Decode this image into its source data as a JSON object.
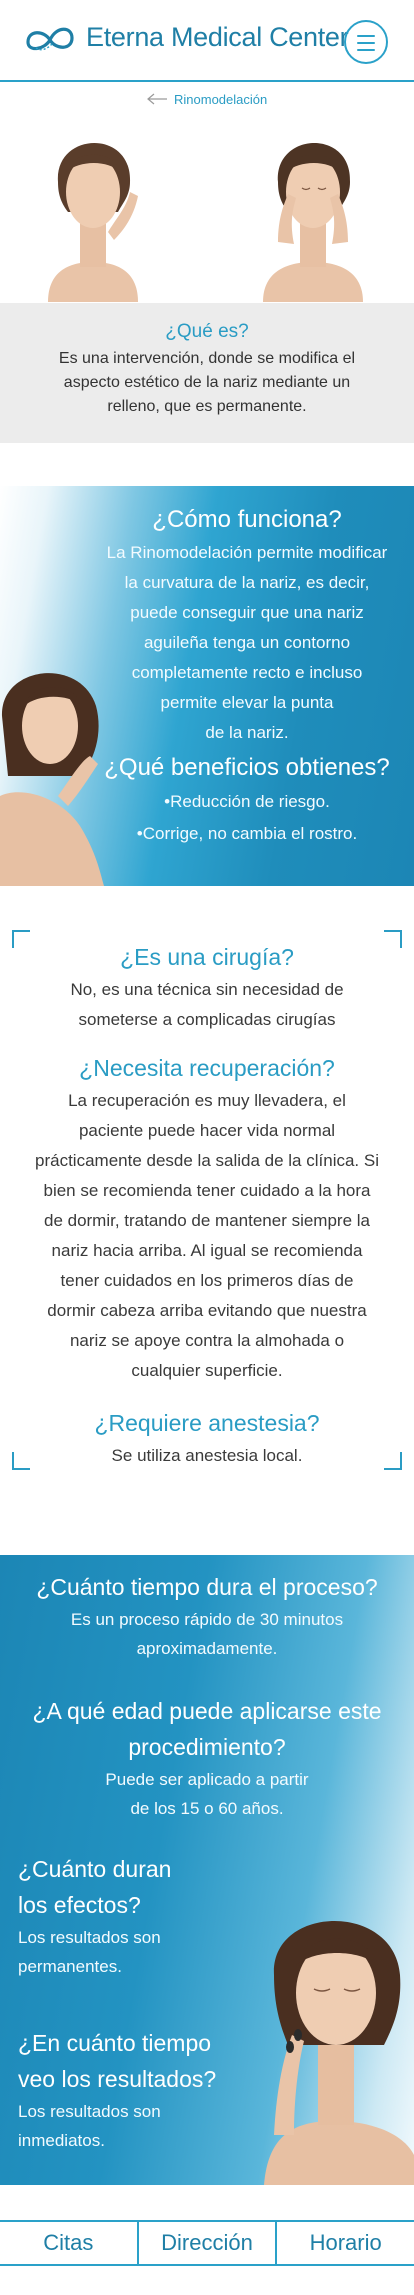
{
  "header": {
    "brand": "Eterna Medical Center",
    "logo_icon": "infinity-logo-icon",
    "menu_icon": "hamburger-menu-icon"
  },
  "breadcrumb": {
    "icon": "arrow-left-icon",
    "label": "Rinomodelación"
  },
  "colors": {
    "accent": "#2aa1c9",
    "brand_text": "#1f7fa6",
    "gray_band": "#ececec",
    "blue": "#1c86b5"
  },
  "what_is": {
    "title": "¿Qué es?",
    "lines": [
      "Es una intervención, donde se modifica el",
      "aspecto estético de la nariz mediante un",
      "relleno, que es permanente."
    ]
  },
  "how_it_works": {
    "title": "¿Cómo funciona?",
    "lines": [
      "La Rinomodelación permite modificar",
      "la curvatura de la nariz, es decir,",
      "puede conseguir que una nariz",
      "aguileña tenga un contorno",
      "completamente recto e incluso",
      "permite elevar la punta",
      "de la nariz."
    ],
    "benefits_title": "¿Qué beneficios obtienes?",
    "benefits": [
      "•Reducción de riesgo.",
      "•Corrige, no cambia el rostro."
    ]
  },
  "surgery": {
    "title": "¿Es una cirugía?",
    "lines": [
      "No, es una técnica sin necesidad de",
      "someterse a complicadas cirugías"
    ]
  },
  "recovery": {
    "title": "¿Necesita recuperación?",
    "lines": [
      "La recuperación es muy llevadera, el",
      "paciente puede hacer vida normal",
      "prácticamente desde la salida de la clínica. Si",
      "bien se recomienda tener cuidado a la hora",
      "de dormir, tratando de mantener siempre la",
      "nariz hacia arriba. Al igual se recomienda",
      "tener cuidados en los primeros días de",
      "dormir cabeza arriba evitando que nuestra",
      "nariz se apoye contra la almohada o",
      "cualquier superficie."
    ]
  },
  "anesthesia": {
    "title": "¿Requiere anestesia?",
    "text": "Se utiliza anestesia local."
  },
  "duration": {
    "title": "¿Cuánto tiempo dura el proceso?",
    "lines": [
      "Es un proceso rápido de 30 minutos",
      "aproximadamente."
    ]
  },
  "age": {
    "title_lines": [
      "¿A qué edad puede aplicarse este",
      "procedimiento?"
    ],
    "lines": [
      "Puede ser aplicado a partir",
      "de los 15 o 60 años."
    ]
  },
  "effects": {
    "title_lines": [
      "¿Cuánto duran",
      "los efectos?"
    ],
    "lines": [
      "Los resultados son",
      "permanentes."
    ]
  },
  "results": {
    "title_lines": [
      "¿En cuánto tiempo",
      "veo los resultados?"
    ],
    "lines": [
      "Los resultados son",
      "inmediatos."
    ]
  },
  "bottom_nav": {
    "items": [
      "Citas",
      "Dirección",
      "Horario"
    ]
  }
}
